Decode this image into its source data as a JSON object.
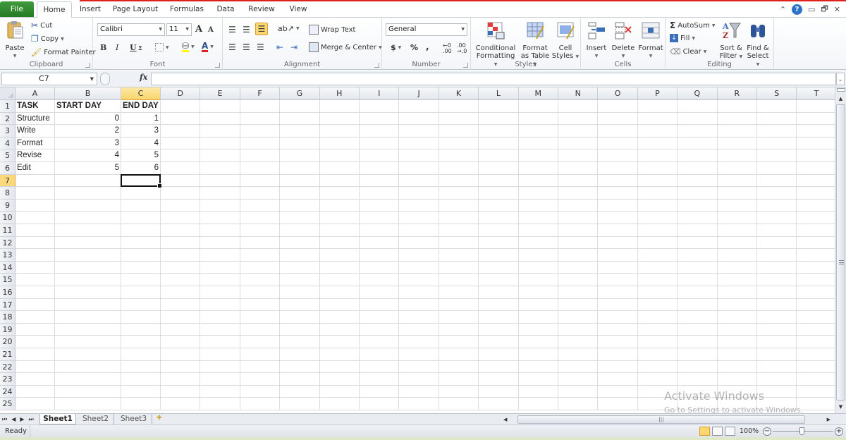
{
  "tabs": {
    "file": "File",
    "items": [
      "Home",
      "Insert",
      "Page Layout",
      "Formulas",
      "Data",
      "Review",
      "View"
    ],
    "active": "Home"
  },
  "window_controls": {
    "minimize_ribbon": "⌃",
    "help": "?",
    "minimize": "▭",
    "restore": "🗗",
    "close": "✕"
  },
  "ribbon": {
    "clipboard": {
      "label": "Clipboard",
      "paste": "Paste",
      "cut": "Cut",
      "copy": "Copy",
      "format_painter": "Format Painter"
    },
    "font": {
      "label": "Font",
      "font_name": "Calibri",
      "font_size": "11",
      "grow": "A",
      "shrink": "A",
      "bold": "B",
      "italic": "I",
      "underline": "U",
      "fill_color": "#ffff00",
      "font_color": "#e02020"
    },
    "alignment": {
      "label": "Alignment",
      "wrap_text": "Wrap Text",
      "merge_center": "Merge & Center"
    },
    "number": {
      "label": "Number",
      "format": "General",
      "currency": "$",
      "percent": "%",
      "comma": ","
    },
    "styles": {
      "label": "Styles",
      "conditional_formatting": [
        "Conditional",
        "Formatting"
      ],
      "format_as_table": [
        "Format",
        "as Table"
      ],
      "cell_styles": [
        "Cell",
        "Styles"
      ]
    },
    "cells": {
      "label": "Cells",
      "insert": "Insert",
      "delete": "Delete",
      "format": "Format"
    },
    "editing": {
      "label": "Editing",
      "autosum": "AutoSum",
      "fill": "Fill",
      "clear": "Clear",
      "sort_filter": [
        "Sort &",
        "Filter"
      ],
      "find_select": [
        "Find &",
        "Select"
      ]
    }
  },
  "formula_bar": {
    "name_box": "C7",
    "fx": "fx",
    "formula": ""
  },
  "grid": {
    "columns": [
      "A",
      "B",
      "C",
      "D",
      "E",
      "F",
      "G",
      "H",
      "I",
      "J",
      "K",
      "L",
      "M",
      "N",
      "O",
      "P",
      "Q",
      "R",
      "S",
      "T"
    ],
    "selected_column": "C",
    "rows": [
      "1",
      "2",
      "3",
      "4",
      "5",
      "6",
      "7",
      "8",
      "9",
      "10",
      "11",
      "12",
      "13",
      "14",
      "15",
      "16",
      "17",
      "18",
      "19",
      "20",
      "21",
      "22",
      "23",
      "24",
      "25"
    ],
    "selected_row": "7",
    "active_cell": "C7",
    "cells": [
      {
        "ref": "A1",
        "value": "TASK",
        "bold": true
      },
      {
        "ref": "B1",
        "value": "START DAY",
        "bold": true
      },
      {
        "ref": "C1",
        "value": "END DAY",
        "bold": true
      },
      {
        "ref": "A2",
        "value": "Structure"
      },
      {
        "ref": "B2",
        "value": "0",
        "num": true
      },
      {
        "ref": "C2",
        "value": "1",
        "num": true
      },
      {
        "ref": "A3",
        "value": "Write"
      },
      {
        "ref": "B3",
        "value": "2",
        "num": true
      },
      {
        "ref": "C3",
        "value": "3",
        "num": true
      },
      {
        "ref": "A4",
        "value": "Format"
      },
      {
        "ref": "B4",
        "value": "3",
        "num": true
      },
      {
        "ref": "C4",
        "value": "4",
        "num": true
      },
      {
        "ref": "A5",
        "value": "Revise"
      },
      {
        "ref": "B5",
        "value": "4",
        "num": true
      },
      {
        "ref": "C5",
        "value": "5",
        "num": true
      },
      {
        "ref": "A6",
        "value": "Edit"
      },
      {
        "ref": "B6",
        "value": "5",
        "num": true
      },
      {
        "ref": "C6",
        "value": "6",
        "num": true
      }
    ]
  },
  "sheets": {
    "tabs": [
      "Sheet1",
      "Sheet2",
      "Sheet3"
    ],
    "active": "Sheet1"
  },
  "status": {
    "text": "Ready",
    "zoom": "100%",
    "zoom_percent": 100
  },
  "watermark": {
    "line1": "Activate Windows",
    "line2": "Go to Settings to activate Windows."
  }
}
